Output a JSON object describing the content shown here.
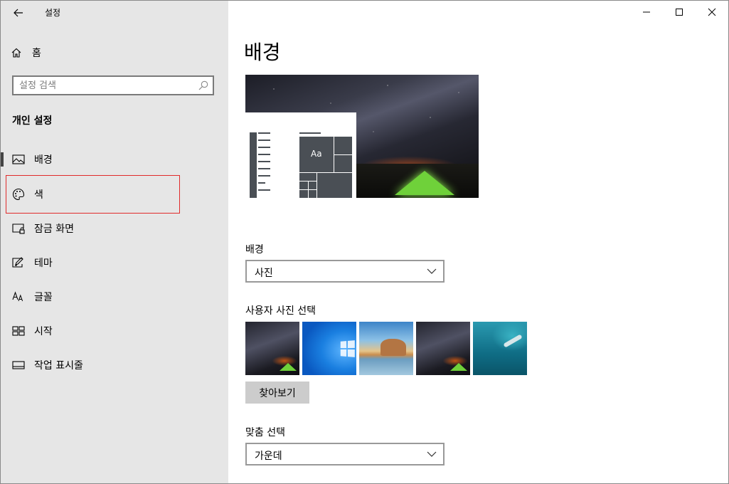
{
  "window": {
    "title": "설정"
  },
  "sidebar": {
    "home_label": "홈",
    "search_placeholder": "설정 검색",
    "section_title": "개인 설정",
    "items": [
      {
        "label": "배경",
        "icon": "picture-icon"
      },
      {
        "label": "색",
        "icon": "palette-icon"
      },
      {
        "label": "잠금 화면",
        "icon": "lock-screen-icon"
      },
      {
        "label": "테마",
        "icon": "theme-icon"
      },
      {
        "label": "글꼴",
        "icon": "font-icon"
      },
      {
        "label": "시작",
        "icon": "start-icon"
      },
      {
        "label": "작업 표시줄",
        "icon": "taskbar-icon"
      }
    ],
    "active_item": "배경",
    "highlighted_item": "색"
  },
  "main": {
    "page_title": "배경",
    "preview_aa": "Aa",
    "background_label": "배경",
    "background_value": "사진",
    "choose_photo_label": "사용자 사진 선택",
    "browse_label": "찾아보기",
    "fit_label": "맞춤 선택",
    "fit_value": "가운데"
  },
  "colors": {
    "sidebar_bg": "#e6e6e6",
    "highlight": "#e02b2b",
    "button_bg": "#cccccc"
  }
}
